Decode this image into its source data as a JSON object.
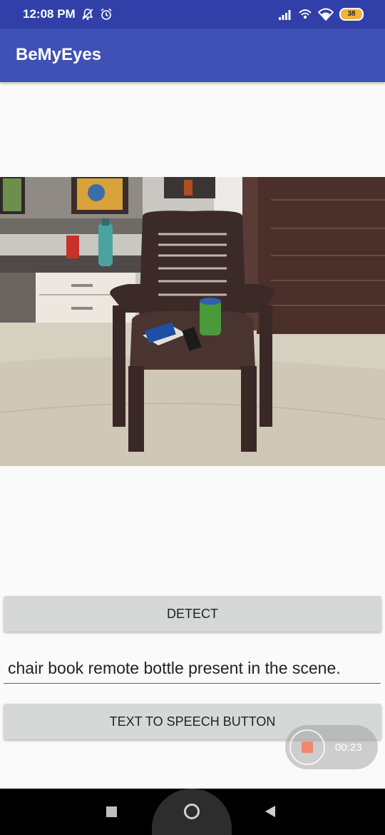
{
  "status_bar": {
    "time": "12:08 PM",
    "battery": "38",
    "icons": [
      "mute-icon",
      "alarm-icon",
      "signal-icon",
      "hotspot-icon",
      "wifi-icon",
      "battery-icon"
    ]
  },
  "app_bar": {
    "title": "BeMyEyes",
    "color": "#3f51b5"
  },
  "photo": {
    "description_icon": "photo-of-chair-with-book-remote-pen-holder"
  },
  "detect_button": {
    "label": "DETECT"
  },
  "result_field": {
    "value": "chair book remote bottle present in the scene."
  },
  "tts_button": {
    "label": "TEXT TO SPEECH BUTTON"
  },
  "screen_recorder": {
    "time": "00:23"
  },
  "nav_bar": {
    "icons": [
      "recents-icon",
      "home-icon",
      "back-icon"
    ]
  }
}
